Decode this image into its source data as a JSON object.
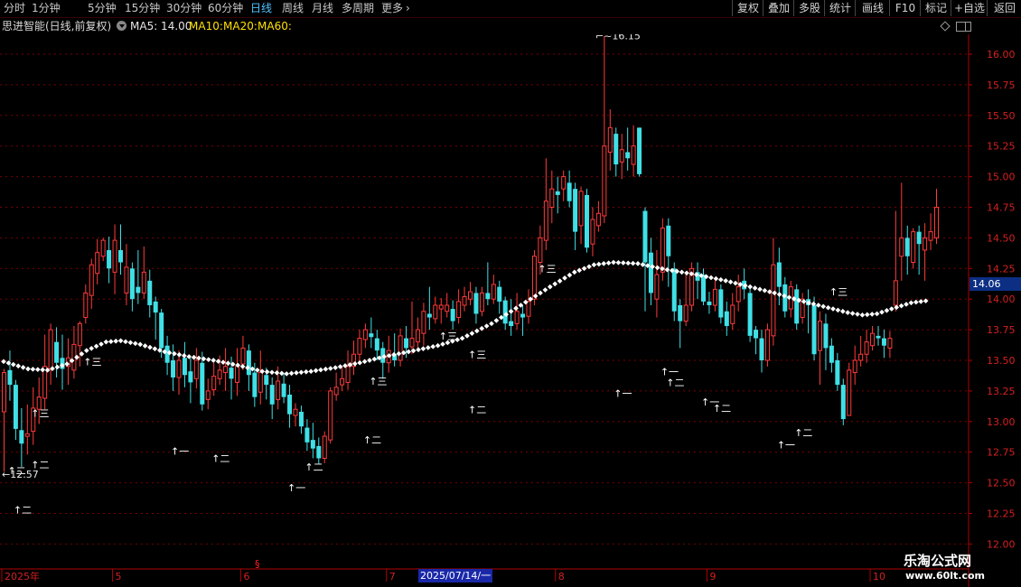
{
  "toolbar": {
    "period_tabs": [
      "分时",
      "1分钟",
      "5分钟",
      "15分钟",
      "30分钟",
      "60分钟",
      "日线",
      "周线",
      "月线",
      "多周期",
      "更多"
    ],
    "active_tab": "日线",
    "right_buttons": [
      "复权",
      "叠加",
      "多股",
      "统计",
      "画线",
      "F10",
      "标记",
      "+自选",
      "返回"
    ]
  },
  "info": {
    "stock_label": "思进智能(日线,前复权)",
    "ma5": "MA5: 14.00",
    "ma10": "MA10:",
    "ma20": "MA20:",
    "ma60": "MA60:"
  },
  "price_tag": "14.06",
  "date_tag": "2025/07/14/一",
  "watermark": {
    "title": "乐淘公式网",
    "url": "www.60lt.com"
  },
  "colors": {
    "up": "#ff3b3b",
    "down": "#3fe0e6",
    "grid": "#7a0000",
    "axis": "#b00000",
    "label": "#d42020",
    "dotted": "#ffffff"
  },
  "chart_data": {
    "type": "candlestick",
    "y_ticks": [
      "12.00",
      "12.25",
      "12.50",
      "12.75",
      "13.00",
      "13.25",
      "13.50",
      "13.75",
      "14.00",
      "14.25",
      "14.50",
      "14.75",
      "15.00",
      "15.25",
      "15.50",
      "15.75",
      "16.00"
    ],
    "ylim": [
      12.0,
      16.1
    ],
    "x_labels": [
      "2025年",
      "5",
      "6",
      "7",
      "8",
      "9",
      "10"
    ],
    "x_label_index": [
      0,
      19,
      41,
      66,
      95,
      121,
      149
    ],
    "high_label": "16.15",
    "low_label": "12.57",
    "candles": [
      [
        13.08,
        13.4,
        13.43,
        12.59
      ],
      [
        13.42,
        13.3,
        13.58,
        13.17
      ],
      [
        13.3,
        12.94,
        13.34,
        12.85
      ],
      [
        12.93,
        12.82,
        13.11,
        12.63
      ],
      [
        12.88,
        12.9,
        13.14,
        12.73
      ],
      [
        12.92,
        13.11,
        13.28,
        12.81
      ],
      [
        13.1,
        13.2,
        13.36,
        12.98
      ],
      [
        13.19,
        13.45,
        13.71,
        13.1
      ],
      [
        13.43,
        13.75,
        13.8,
        13.3
      ],
      [
        13.65,
        13.48,
        13.77,
        13.36
      ],
      [
        13.52,
        13.43,
        13.71,
        13.26
      ],
      [
        13.45,
        13.52,
        13.68,
        13.3
      ],
      [
        13.42,
        13.63,
        13.78,
        13.35
      ],
      [
        13.62,
        13.8,
        13.82,
        13.45
      ],
      [
        13.85,
        14.05,
        14.12,
        13.8
      ],
      [
        14.03,
        14.28,
        14.33,
        13.92
      ],
      [
        14.21,
        14.38,
        14.49,
        14.12
      ],
      [
        14.35,
        14.48,
        14.5,
        14.31
      ],
      [
        14.4,
        14.25,
        14.51,
        14.13
      ],
      [
        14.22,
        14.48,
        14.61,
        14.04
      ],
      [
        14.4,
        14.3,
        14.61,
        14.2
      ],
      [
        14.05,
        14.26,
        14.45,
        13.95
      ],
      [
        14.25,
        14.0,
        14.3,
        13.9
      ],
      [
        14.1,
        14.05,
        14.4,
        13.96
      ],
      [
        14.05,
        14.22,
        14.43,
        14.0
      ],
      [
        14.15,
        13.95,
        14.24,
        13.85
      ],
      [
        13.98,
        13.89,
        14.02,
        13.67
      ],
      [
        13.89,
        13.6,
        13.92,
        13.52
      ],
      [
        13.62,
        13.48,
        13.7,
        13.38
      ],
      [
        13.5,
        13.36,
        13.63,
        13.25
      ],
      [
        13.36,
        13.5,
        13.58,
        13.22
      ],
      [
        13.52,
        13.38,
        13.65,
        13.28
      ],
      [
        13.41,
        13.32,
        13.52,
        13.15
      ],
      [
        13.35,
        13.5,
        13.6,
        13.27
      ],
      [
        13.48,
        13.14,
        13.57,
        13.09
      ],
      [
        13.18,
        13.25,
        13.35,
        13.1
      ],
      [
        13.26,
        13.37,
        13.48,
        13.21
      ],
      [
        13.35,
        13.42,
        13.54,
        13.3
      ],
      [
        13.4,
        13.45,
        13.6,
        13.25
      ],
      [
        13.44,
        13.35,
        13.53,
        13.18
      ],
      [
        13.32,
        13.45,
        13.6,
        13.21
      ],
      [
        13.47,
        13.6,
        13.7,
        13.42
      ],
      [
        13.58,
        13.38,
        13.63,
        13.25
      ],
      [
        13.4,
        13.2,
        13.48,
        13.12
      ],
      [
        13.24,
        13.4,
        13.58,
        13.14
      ],
      [
        13.38,
        13.3,
        13.44,
        13.18
      ],
      [
        13.3,
        13.14,
        13.36,
        13.02
      ],
      [
        13.18,
        13.33,
        13.45,
        13.1
      ],
      [
        13.31,
        13.2,
        13.4,
        13.15
      ],
      [
        13.22,
        13.06,
        13.3,
        12.95
      ],
      [
        13.05,
        13.1,
        13.15,
        12.96
      ],
      [
        13.08,
        12.96,
        13.13,
        12.9
      ],
      [
        12.95,
        12.83,
        13.02,
        12.76
      ],
      [
        12.85,
        12.78,
        12.99,
        12.7
      ],
      [
        12.8,
        12.7,
        12.87,
        12.65
      ],
      [
        12.7,
        12.88,
        12.92,
        12.66
      ],
      [
        12.85,
        13.25,
        13.28,
        12.82
      ],
      [
        13.22,
        13.28,
        13.4,
        13.17
      ],
      [
        13.3,
        13.35,
        13.45,
        13.25
      ],
      [
        13.32,
        13.45,
        13.58,
        13.26
      ],
      [
        13.45,
        13.55,
        13.66,
        13.38
      ],
      [
        13.55,
        13.68,
        13.75,
        13.5
      ],
      [
        13.67,
        13.75,
        13.8,
        13.6
      ],
      [
        13.72,
        13.69,
        13.85,
        13.6
      ],
      [
        13.68,
        13.58,
        13.75,
        13.5
      ],
      [
        13.6,
        13.48,
        13.65,
        13.35
      ],
      [
        13.48,
        13.58,
        13.7,
        13.4
      ],
      [
        13.55,
        13.5,
        13.72,
        13.45
      ],
      [
        13.5,
        13.7,
        13.76,
        13.45
      ],
      [
        13.68,
        13.6,
        13.78,
        13.52
      ],
      [
        13.61,
        13.68,
        13.98,
        13.55
      ],
      [
        13.65,
        13.75,
        13.85,
        13.6
      ],
      [
        13.72,
        13.9,
        13.97,
        13.62
      ],
      [
        13.88,
        13.85,
        14.1,
        13.75
      ],
      [
        13.84,
        13.95,
        14.02,
        13.8
      ],
      [
        13.92,
        13.95,
        14.01,
        13.8
      ],
      [
        13.9,
        13.95,
        14.05,
        13.85
      ],
      [
        13.92,
        13.82,
        13.99,
        13.75
      ],
      [
        13.85,
        13.98,
        14.08,
        13.8
      ],
      [
        13.95,
        14.02,
        14.1,
        13.9
      ],
      [
        14.0,
        14.06,
        14.14,
        13.95
      ],
      [
        14.05,
        13.88,
        14.1,
        13.8
      ],
      [
        13.9,
        14.05,
        14.1,
        13.86
      ],
      [
        14.05,
        14.0,
        14.3,
        13.95
      ],
      [
        14.0,
        14.12,
        14.2,
        13.96
      ],
      [
        14.1,
        13.98,
        14.15,
        13.88
      ],
      [
        13.99,
        13.8,
        14.02,
        13.75
      ],
      [
        13.82,
        13.78,
        14.0,
        13.7
      ],
      [
        13.8,
        13.9,
        14.05,
        13.75
      ],
      [
        13.88,
        13.85,
        13.95,
        13.7
      ],
      [
        13.86,
        13.98,
        14.08,
        13.8
      ],
      [
        14.0,
        14.35,
        14.4,
        13.95
      ],
      [
        14.3,
        14.5,
        14.6,
        14.2
      ],
      [
        14.48,
        14.8,
        15.15,
        14.4
      ],
      [
        14.75,
        14.9,
        15.05,
        14.62
      ],
      [
        14.88,
        14.85,
        15.0,
        14.7
      ],
      [
        14.9,
        15.0,
        15.05,
        14.8
      ],
      [
        14.95,
        14.8,
        15.05,
        14.75
      ],
      [
        14.9,
        14.55,
        14.95,
        14.4
      ],
      [
        14.6,
        14.88,
        14.92,
        14.45
      ],
      [
        14.85,
        14.42,
        14.9,
        14.38
      ],
      [
        14.45,
        14.65,
        14.75,
        14.35
      ],
      [
        14.6,
        14.7,
        14.8,
        14.55
      ],
      [
        14.68,
        15.25,
        16.15,
        14.62
      ],
      [
        15.2,
        15.4,
        15.55,
        15.05
      ],
      [
        15.35,
        15.1,
        15.4,
        15.0
      ],
      [
        15.12,
        15.22,
        15.35,
        14.98
      ],
      [
        15.2,
        15.15,
        15.4,
        15.05
      ],
      [
        15.1,
        15.25,
        15.42,
        15.0
      ],
      [
        15.4,
        15.02,
        15.4,
        15.0
      ],
      [
        14.72,
        14.3,
        14.75,
        13.9
      ],
      [
        14.38,
        14.05,
        14.5,
        13.95
      ],
      [
        14.0,
        14.2,
        14.4,
        13.85
      ],
      [
        14.22,
        14.58,
        14.66,
        14.15
      ],
      [
        14.6,
        14.35,
        14.66,
        14.1
      ],
      [
        14.25,
        13.9,
        14.3,
        13.82
      ],
      [
        13.95,
        13.82,
        14.0,
        13.6
      ],
      [
        13.82,
        13.95,
        14.2,
        13.78
      ],
      [
        13.95,
        14.25,
        14.3,
        13.9
      ],
      [
        14.22,
        14.15,
        14.3,
        14.0
      ],
      [
        14.2,
        13.98,
        14.25,
        13.95
      ],
      [
        13.98,
        13.95,
        14.06,
        13.88
      ],
      [
        13.95,
        14.08,
        14.15,
        13.9
      ],
      [
        14.08,
        13.85,
        14.12,
        13.8
      ],
      [
        13.9,
        13.78,
        13.98,
        13.7
      ],
      [
        13.8,
        13.95,
        14.05,
        13.75
      ],
      [
        13.98,
        14.1,
        14.2,
        13.9
      ],
      [
        14.15,
        14.08,
        14.25,
        14.0
      ],
      [
        14.05,
        13.7,
        14.1,
        13.65
      ],
      [
        13.75,
        13.68,
        13.78,
        13.55
      ],
      [
        13.68,
        13.5,
        13.75,
        13.4
      ],
      [
        13.5,
        13.75,
        13.8,
        13.45
      ],
      [
        13.7,
        14.28,
        14.5,
        13.62
      ],
      [
        14.3,
        14.1,
        14.42,
        13.95
      ],
      [
        14.12,
        13.9,
        14.18,
        13.85
      ],
      [
        13.92,
        14.1,
        14.15,
        13.85
      ],
      [
        14.08,
        13.8,
        14.12,
        13.75
      ],
      [
        13.85,
        14.0,
        14.05,
        13.8
      ],
      [
        14.0,
        13.95,
        14.08,
        13.72
      ],
      [
        13.95,
        13.55,
        14.02,
        13.5
      ],
      [
        13.58,
        13.82,
        13.9,
        13.3
      ],
      [
        13.8,
        13.6,
        13.88,
        13.42
      ],
      [
        13.62,
        13.48,
        13.68,
        13.4
      ],
      [
        13.5,
        13.3,
        13.56,
        13.25
      ],
      [
        13.3,
        13.02,
        13.35,
        12.97
      ],
      [
        13.05,
        13.42,
        13.48,
        13.05
      ],
      [
        13.4,
        13.5,
        13.62,
        13.3
      ],
      [
        13.5,
        13.55,
        13.7,
        13.45
      ],
      [
        13.55,
        13.65,
        13.75,
        13.48
      ],
      [
        13.62,
        13.72,
        13.78,
        13.58
      ],
      [
        13.7,
        13.68,
        13.78,
        13.62
      ],
      [
        13.68,
        13.62,
        13.75,
        13.52
      ],
      [
        13.6,
        13.68,
        13.74,
        13.52
      ],
      [
        13.95,
        14.15,
        14.72,
        13.9
      ],
      [
        14.35,
        14.5,
        14.95,
        14.15
      ],
      [
        14.5,
        14.35,
        14.6,
        14.2
      ],
      [
        14.3,
        14.55,
        14.58,
        14.25
      ],
      [
        14.55,
        14.45,
        14.6,
        14.2
      ],
      [
        14.4,
        14.5,
        14.62,
        14.15
      ],
      [
        14.48,
        14.55,
        14.7,
        14.4
      ],
      [
        14.5,
        14.75,
        14.9,
        14.45
      ]
    ],
    "dotted_line": [
      [
        0,
        13.49
      ],
      [
        10,
        13.43
      ],
      [
        18,
        13.42
      ],
      [
        26,
        13.47
      ],
      [
        34,
        13.58
      ],
      [
        42,
        13.65
      ],
      [
        48,
        13.66
      ],
      [
        56,
        13.63
      ],
      [
        66,
        13.57
      ],
      [
        76,
        13.53
      ],
      [
        86,
        13.5
      ],
      [
        96,
        13.46
      ],
      [
        106,
        13.41
      ],
      [
        116,
        13.39
      ],
      [
        126,
        13.41
      ],
      [
        136,
        13.44
      ],
      [
        146,
        13.48
      ],
      [
        156,
        13.53
      ],
      [
        166,
        13.57
      ],
      [
        178,
        13.62
      ],
      [
        188,
        13.68
      ],
      [
        200,
        13.8
      ],
      [
        212,
        13.95
      ],
      [
        224,
        14.1
      ],
      [
        234,
        14.22
      ],
      [
        242,
        14.28
      ],
      [
        250,
        14.3
      ],
      [
        260,
        14.29
      ],
      [
        272,
        14.24
      ],
      [
        284,
        14.2
      ],
      [
        296,
        14.15
      ],
      [
        306,
        14.1
      ],
      [
        316,
        14.05
      ],
      [
        326,
        13.99
      ],
      [
        336,
        13.94
      ],
      [
        346,
        13.89
      ],
      [
        352,
        13.87
      ],
      [
        358,
        13.88
      ],
      [
        364,
        13.92
      ],
      [
        372,
        13.97
      ],
      [
        380,
        13.99
      ]
    ],
    "annotations": [
      {
        "i": 1,
        "price": 12.57,
        "text": "↑二"
      },
      {
        "i": 5,
        "price": 13.04,
        "text": "↑三"
      },
      {
        "i": 5,
        "price": 12.62,
        "text": "↑二"
      },
      {
        "i": 14,
        "price": 13.46,
        "text": "↑三"
      },
      {
        "i": 2,
        "price": 12.25,
        "text": "↑二"
      },
      {
        "i": 29,
        "price": 12.73,
        "text": "↑一"
      },
      {
        "i": 36,
        "price": 12.67,
        "text": "↑二"
      },
      {
        "i": 52,
        "price": 12.6,
        "text": "↑二"
      },
      {
        "i": 49,
        "price": 12.43,
        "text": "↑一"
      },
      {
        "i": 63,
        "price": 13.3,
        "text": "↑三"
      },
      {
        "i": 62,
        "price": 12.82,
        "text": "↑二"
      },
      {
        "i": 75,
        "price": 13.67,
        "text": "↑三"
      },
      {
        "i": 80,
        "price": 13.52,
        "text": "↑三"
      },
      {
        "i": 80,
        "price": 13.07,
        "text": "↑二"
      },
      {
        "i": 92,
        "price": 14.22,
        "text": "↑三"
      },
      {
        "i": 105,
        "price": 13.2,
        "text": "↑一"
      },
      {
        "i": 113,
        "price": 13.38,
        "text": "↑一"
      },
      {
        "i": 114,
        "price": 13.29,
        "text": "↑二"
      },
      {
        "i": 120,
        "price": 13.13,
        "text": "↑一"
      },
      {
        "i": 122,
        "price": 13.08,
        "text": "↑二"
      },
      {
        "i": 133,
        "price": 12.78,
        "text": "↑一"
      },
      {
        "i": 136,
        "price": 12.88,
        "text": "↑二"
      },
      {
        "i": 142,
        "price": 14.03,
        "text": "↑三"
      }
    ]
  }
}
